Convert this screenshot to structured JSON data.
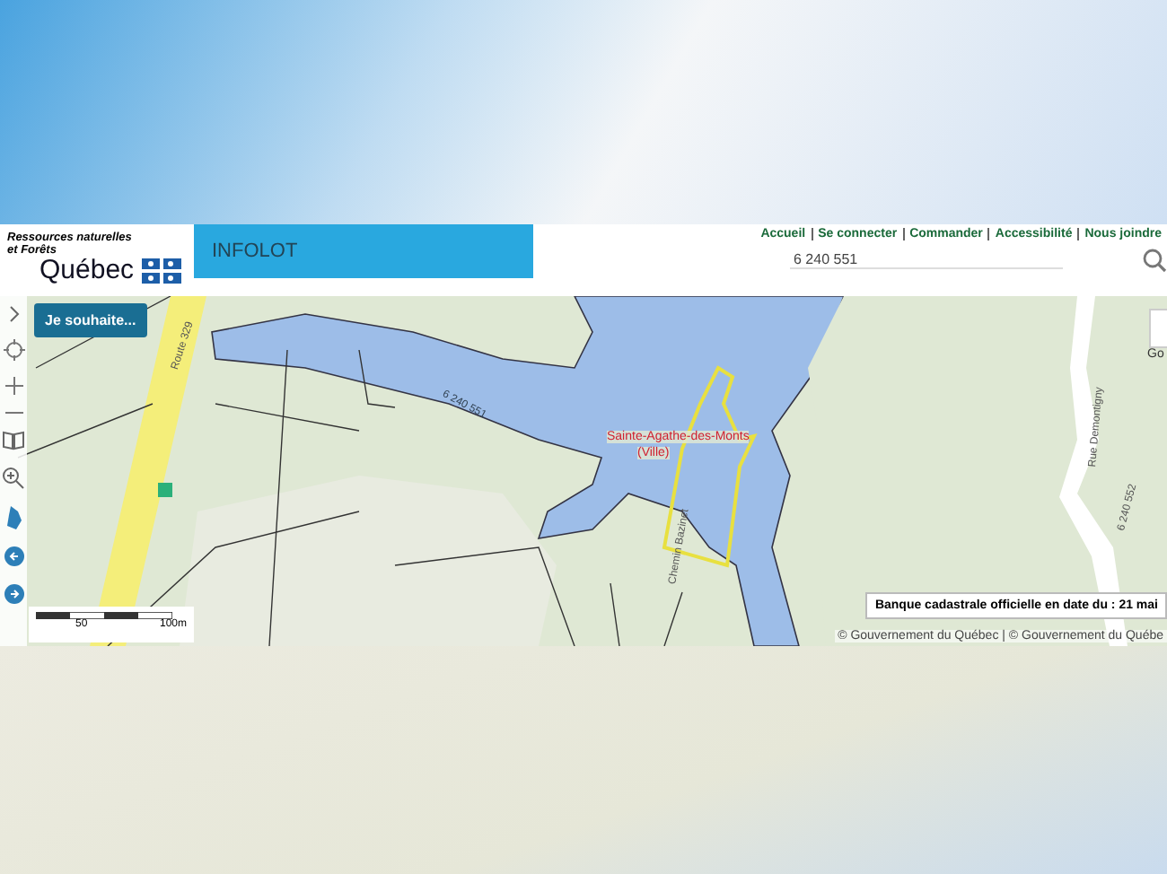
{
  "header": {
    "ministry": [
      "Ressources naturelles",
      "et Forêts"
    ],
    "logo": "Québec",
    "app_title": "INFOLOT",
    "links": [
      "Accueil",
      "Se connecter",
      "Commander",
      "Accessibilité",
      "Nous joindre"
    ],
    "search": {
      "value": "6 240 551"
    }
  },
  "map": {
    "action_button": "Je souhaite...",
    "labels": [
      {
        "kind": "road",
        "text": "Route 329"
      },
      {
        "kind": "water",
        "text": "6 240 551"
      },
      {
        "kind": "place",
        "text": "Sainte-Agathe-des-Monts"
      },
      {
        "kind": "place",
        "text": "(Ville)"
      },
      {
        "kind": "road",
        "text": "Chemin Bazinet"
      },
      {
        "kind": "road",
        "text": "Rue Demontigny"
      },
      {
        "kind": "road",
        "text": "6 240 552"
      }
    ],
    "scale": [
      "50",
      "100m"
    ],
    "thumbnail_label": "Go",
    "date_notice": "Banque cadastrale officielle en date du : 21 mai",
    "attribution": "© Gouvernement du Québec | © Gouvernement du Québe"
  }
}
